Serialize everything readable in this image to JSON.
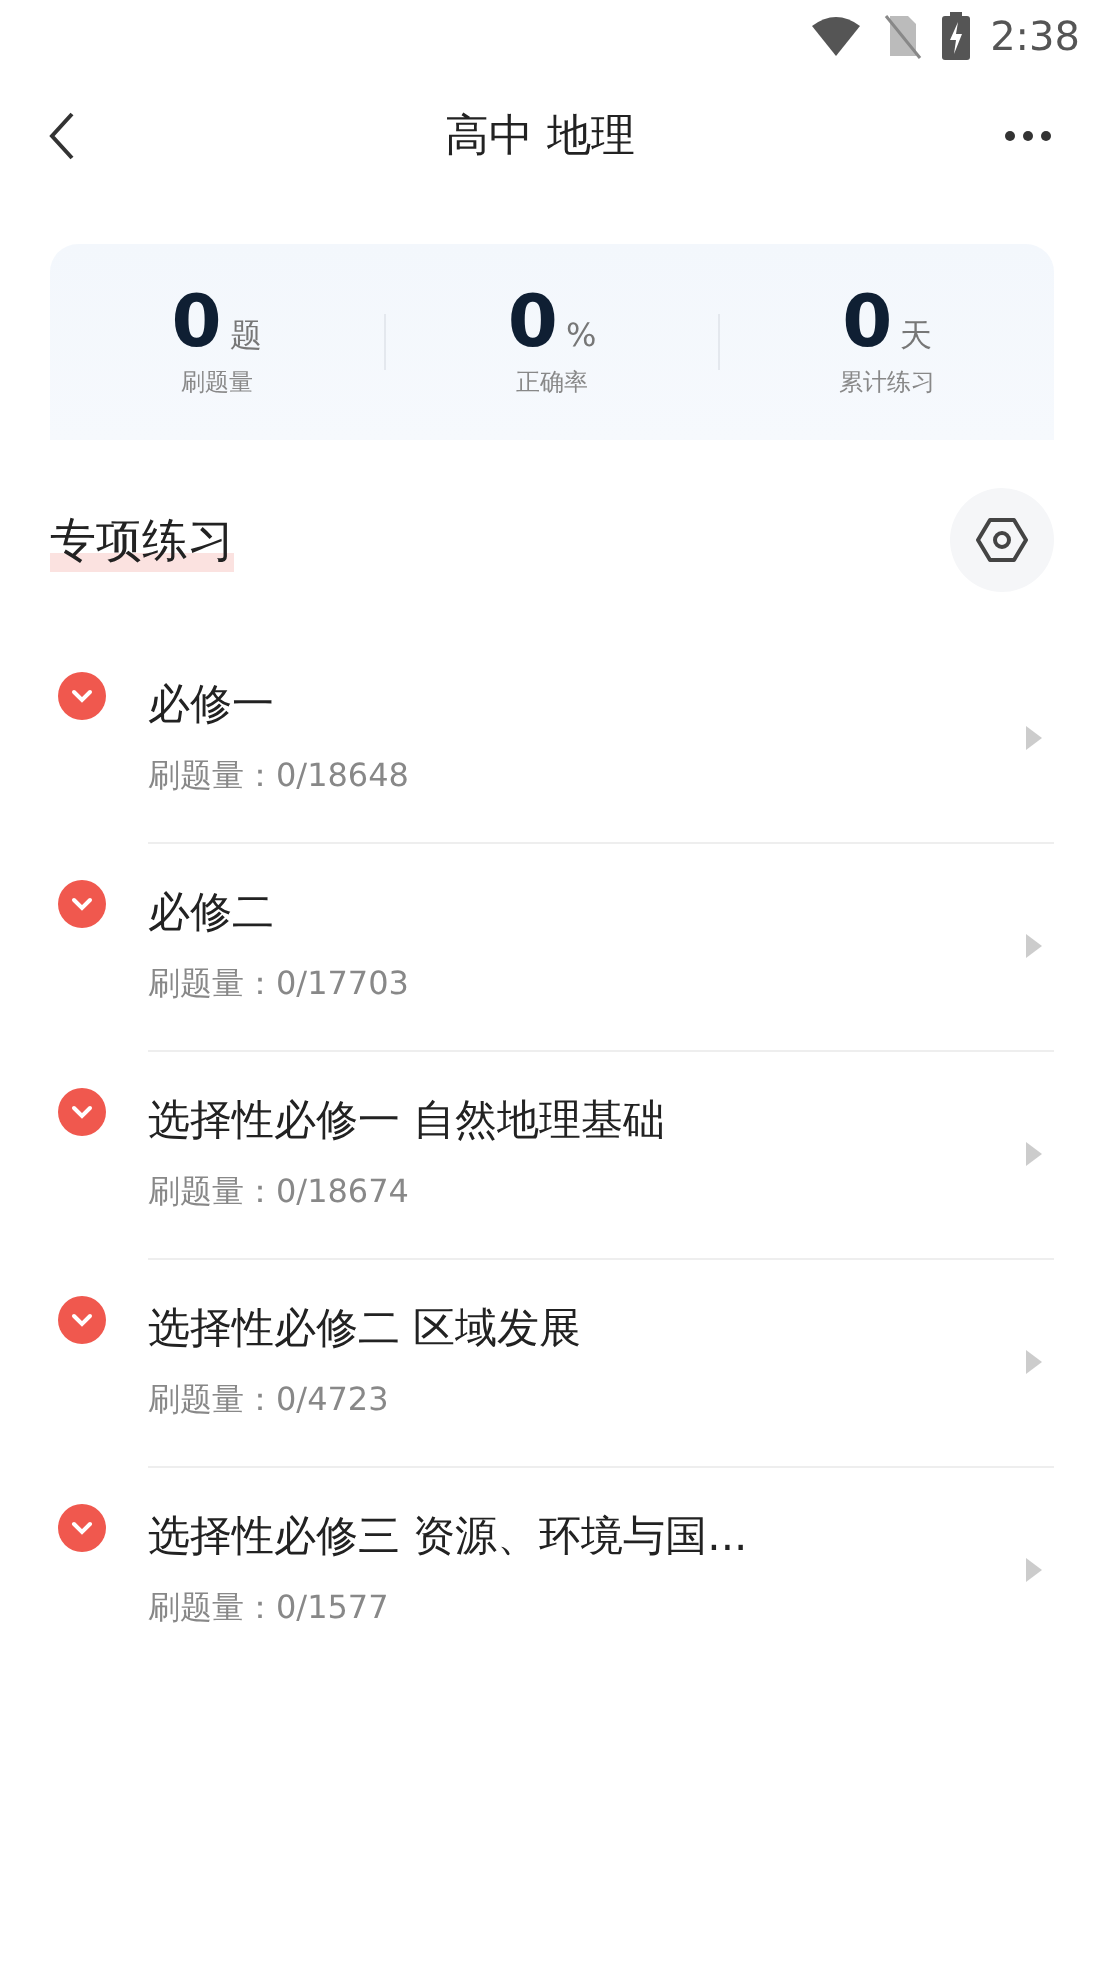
{
  "status_bar": {
    "time": "2:38"
  },
  "header": {
    "title": "高中 地理"
  },
  "stats": [
    {
      "value": "0",
      "unit": "题",
      "label": "刷题量"
    },
    {
      "value": "0",
      "unit": "%",
      "label": "正确率"
    },
    {
      "value": "0",
      "unit": "天",
      "label": "累计练习"
    }
  ],
  "section": {
    "title": "专项练习"
  },
  "items": [
    {
      "title": "必修一",
      "count": "刷题量：0/18648"
    },
    {
      "title": "必修二",
      "count": "刷题量：0/17703"
    },
    {
      "title": "选择性必修一 自然地理基础",
      "count": "刷题量：0/18674"
    },
    {
      "title": "选择性必修二 区域发展",
      "count": "刷题量：0/4723"
    },
    {
      "title": "选择性必修三 资源、环境与国...",
      "count": "刷题量：0/1577"
    }
  ]
}
